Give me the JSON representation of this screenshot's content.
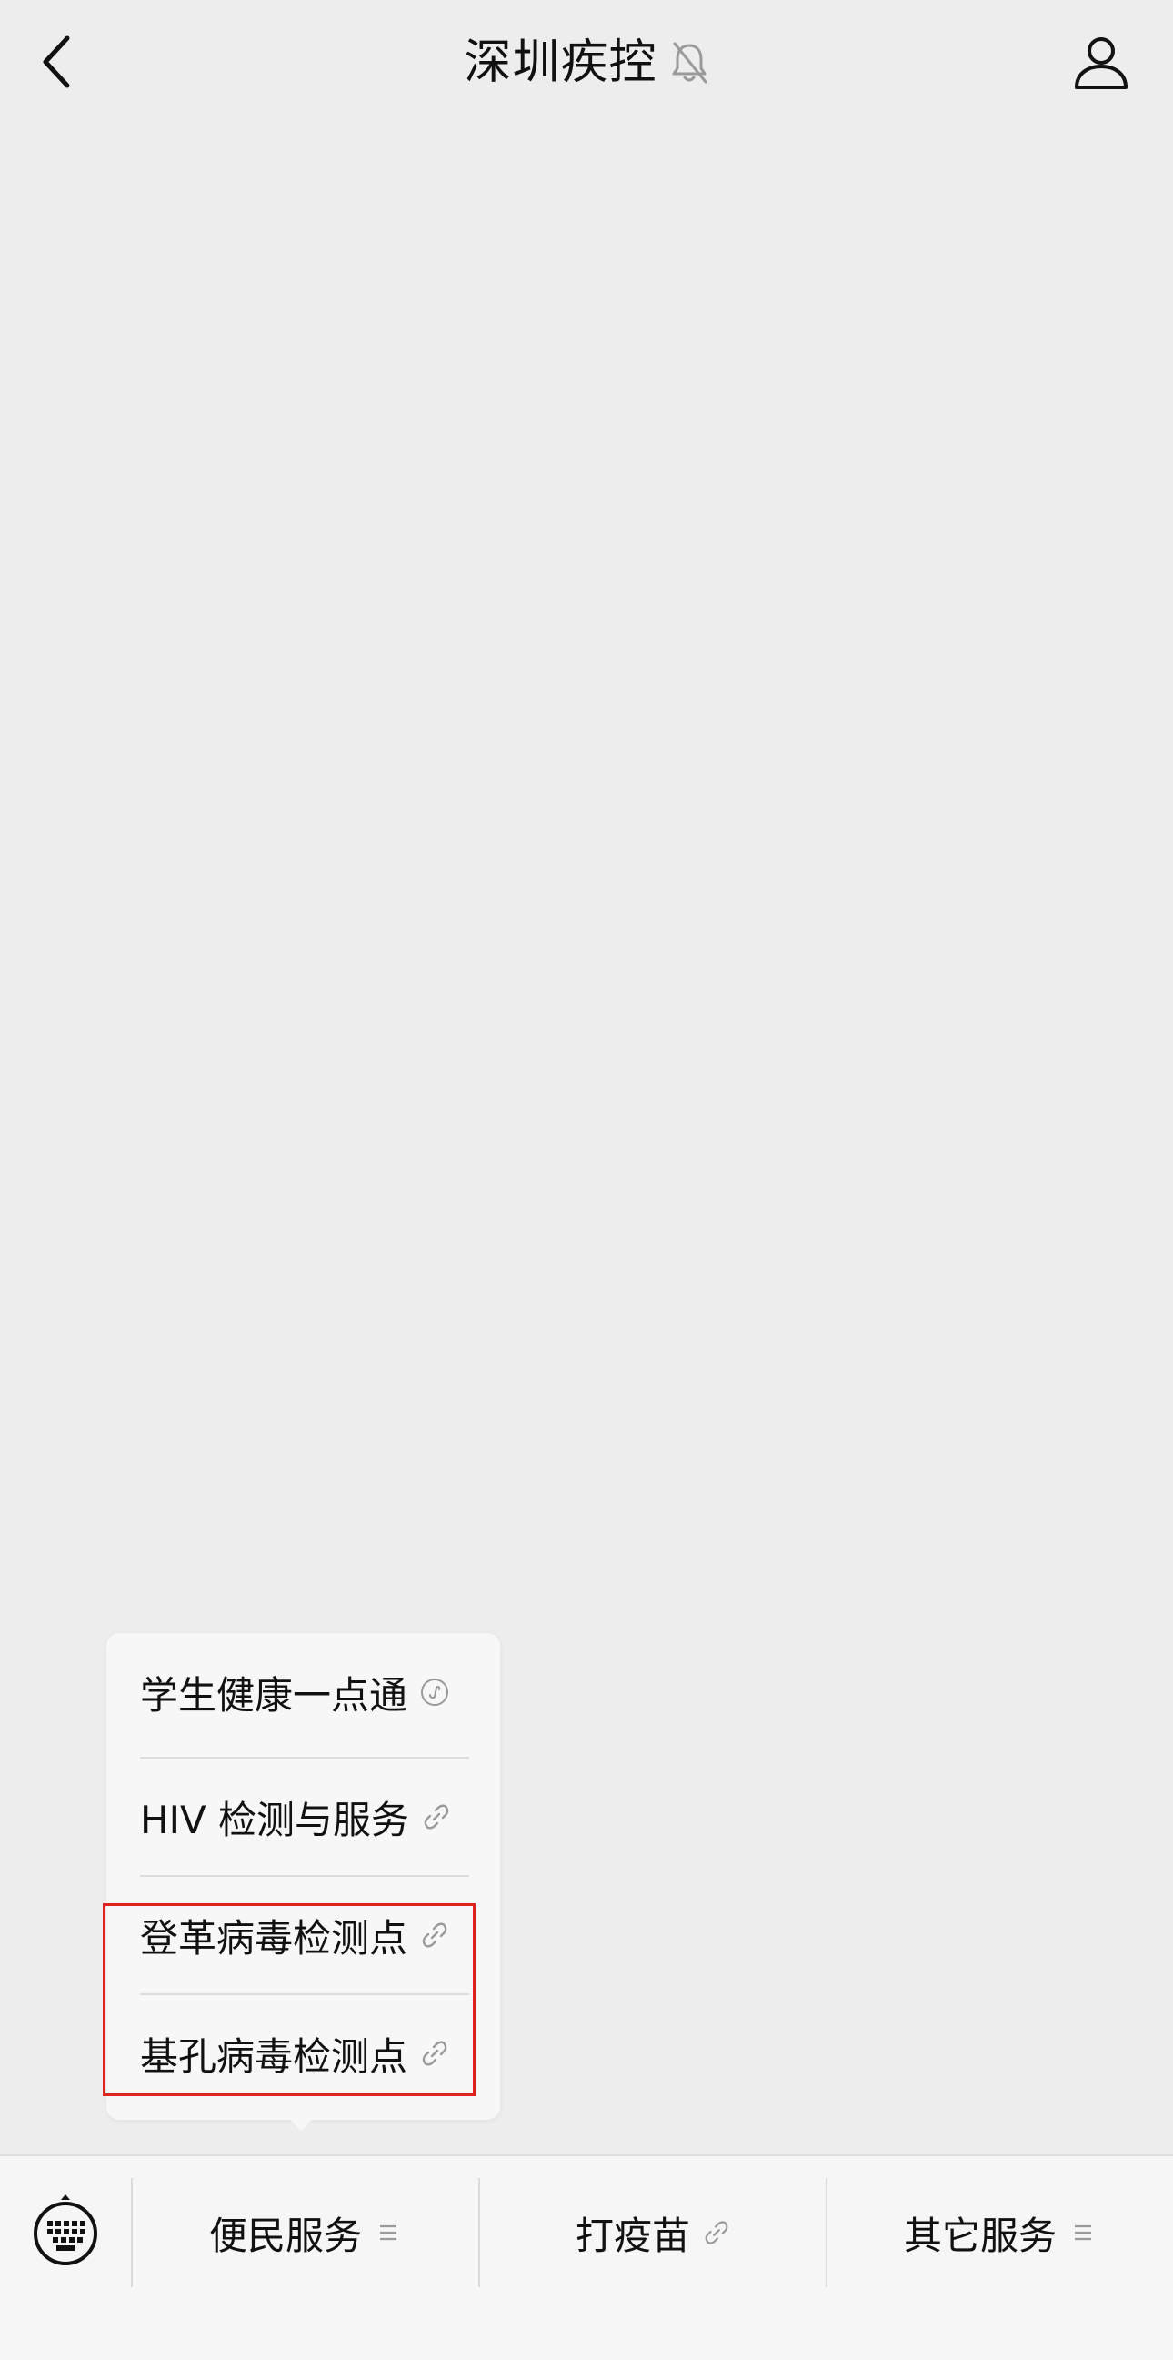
{
  "header": {
    "title": "深圳疾控",
    "back_icon": "chevron-left-icon",
    "mute_icon": "bell-muted-icon",
    "profile_icon": "person-icon"
  },
  "popup_menu": {
    "items": [
      {
        "label": "学生健康一点通",
        "icon": "mini-program-icon"
      },
      {
        "label": "HIV 检测与服务",
        "icon": "link-icon"
      },
      {
        "label": "登革病毒检测点",
        "icon": "link-icon"
      },
      {
        "label": "基孔病毒检测点",
        "icon": "link-icon"
      }
    ]
  },
  "bottom_menu": {
    "keyboard_icon": "keyboard-icon",
    "items": [
      {
        "label": "便民服务",
        "icon": "menu-lines-icon"
      },
      {
        "label": "打疫苗",
        "icon": "link-icon"
      },
      {
        "label": "其它服务",
        "icon": "menu-lines-icon"
      }
    ]
  },
  "colors": {
    "background": "#ededed",
    "popup_background": "#f7f7f7",
    "bar_background": "#f6f6f6",
    "highlight": "#e0231f",
    "text": "#111111",
    "icon_gray": "#9a9a9a"
  }
}
